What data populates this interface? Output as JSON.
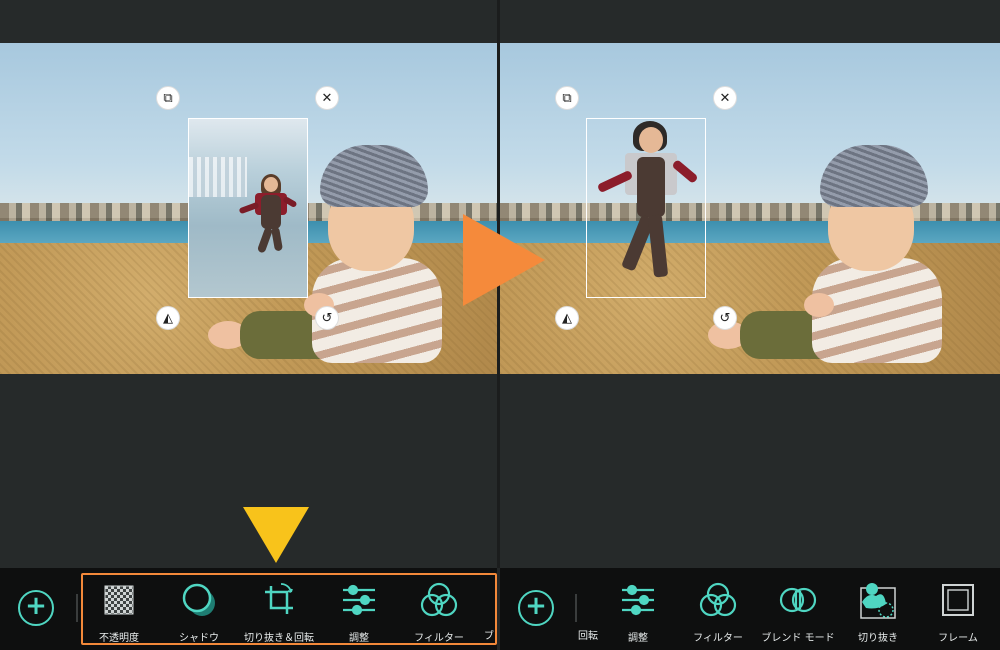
{
  "left_panel": {
    "handles": {
      "duplicate_icon": "⧉",
      "close_icon": "✕",
      "flip_icon": "◭",
      "rotate_icon": "↺"
    }
  },
  "right_panel": {
    "handles": {
      "duplicate_icon": "⧉",
      "close_icon": "✕",
      "flip_icon": "◭",
      "rotate_icon": "↺"
    }
  },
  "toolbar_left": {
    "add_label": "+",
    "tools": [
      {
        "label": "不透明度",
        "icon": "opacity-icon"
      },
      {
        "label": "シャドウ",
        "icon": "shadow-icon"
      },
      {
        "label": "切り抜き＆回転",
        "icon": "crop-rotate-icon"
      },
      {
        "label": "調整",
        "icon": "adjust-icon"
      },
      {
        "label": "フィルター",
        "icon": "filter-icon"
      }
    ],
    "partial_label": "ブ"
  },
  "toolbar_right": {
    "add_label": "+",
    "partial_label": "回転",
    "tools": [
      {
        "label": "調整",
        "icon": "adjust-icon"
      },
      {
        "label": "フィルター",
        "icon": "filter-icon"
      },
      {
        "label": "ブレンド モード",
        "icon": "blend-mode-icon"
      },
      {
        "label": "切り抜き",
        "icon": "cutout-icon"
      },
      {
        "label": "フレーム",
        "icon": "frame-icon"
      }
    ]
  },
  "colors": {
    "accent": "#4fd6c2",
    "highlight_border": "#f3893a",
    "arrow_right": "#f58a3b",
    "arrow_down": "#f8c31b",
    "toolbar_bg": "#0e0f0f"
  }
}
